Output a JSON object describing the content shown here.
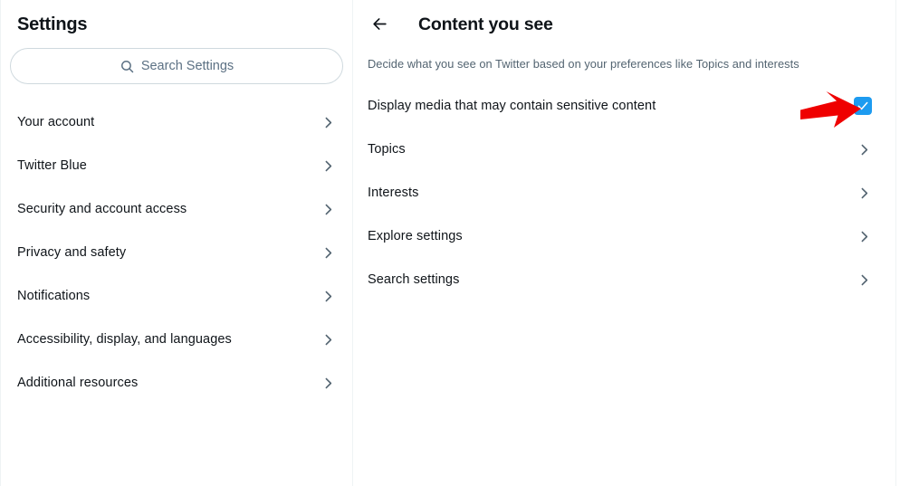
{
  "sidebar": {
    "title": "Settings",
    "search": {
      "placeholder": "Search Settings",
      "value": "",
      "icon": "search-icon"
    },
    "items": [
      {
        "label": "Your account",
        "chevron": "chevron-right-icon"
      },
      {
        "label": "Twitter Blue",
        "chevron": "chevron-right-icon"
      },
      {
        "label": "Security and account access",
        "chevron": "chevron-right-icon"
      },
      {
        "label": "Privacy and safety",
        "chevron": "chevron-right-icon"
      },
      {
        "label": "Notifications",
        "chevron": "chevron-right-icon"
      },
      {
        "label": "Accessibility, display, and languages",
        "chevron": "chevron-right-icon"
      },
      {
        "label": "Additional resources",
        "chevron": "chevron-right-icon"
      }
    ]
  },
  "detail": {
    "back_icon": "arrow-left-icon",
    "title": "Content you see",
    "description": "Decide what you see on Twitter based on your preferences like Topics and interests",
    "sensitive_media": {
      "label": "Display media that may contain sensitive content",
      "checked": true,
      "check_icon": "checkmark-icon"
    },
    "items": [
      {
        "label": "Topics",
        "chevron": "chevron-right-icon"
      },
      {
        "label": "Interests",
        "chevron": "chevron-right-icon"
      },
      {
        "label": "Explore settings",
        "chevron": "chevron-right-icon"
      },
      {
        "label": "Search settings",
        "chevron": "chevron-right-icon"
      }
    ]
  },
  "annotation": {
    "arrow_icon": "red-arrow-pointer",
    "color": "#ef0000",
    "points_to": "sensitive-media-checkbox"
  },
  "colors": {
    "accent": "#1d9bf0",
    "text_primary": "#0f1419",
    "text_secondary": "#536471",
    "border": "#eff3f4",
    "input_border": "#cfd9de",
    "annotation_red": "#ef0000",
    "background": "#ffffff"
  }
}
